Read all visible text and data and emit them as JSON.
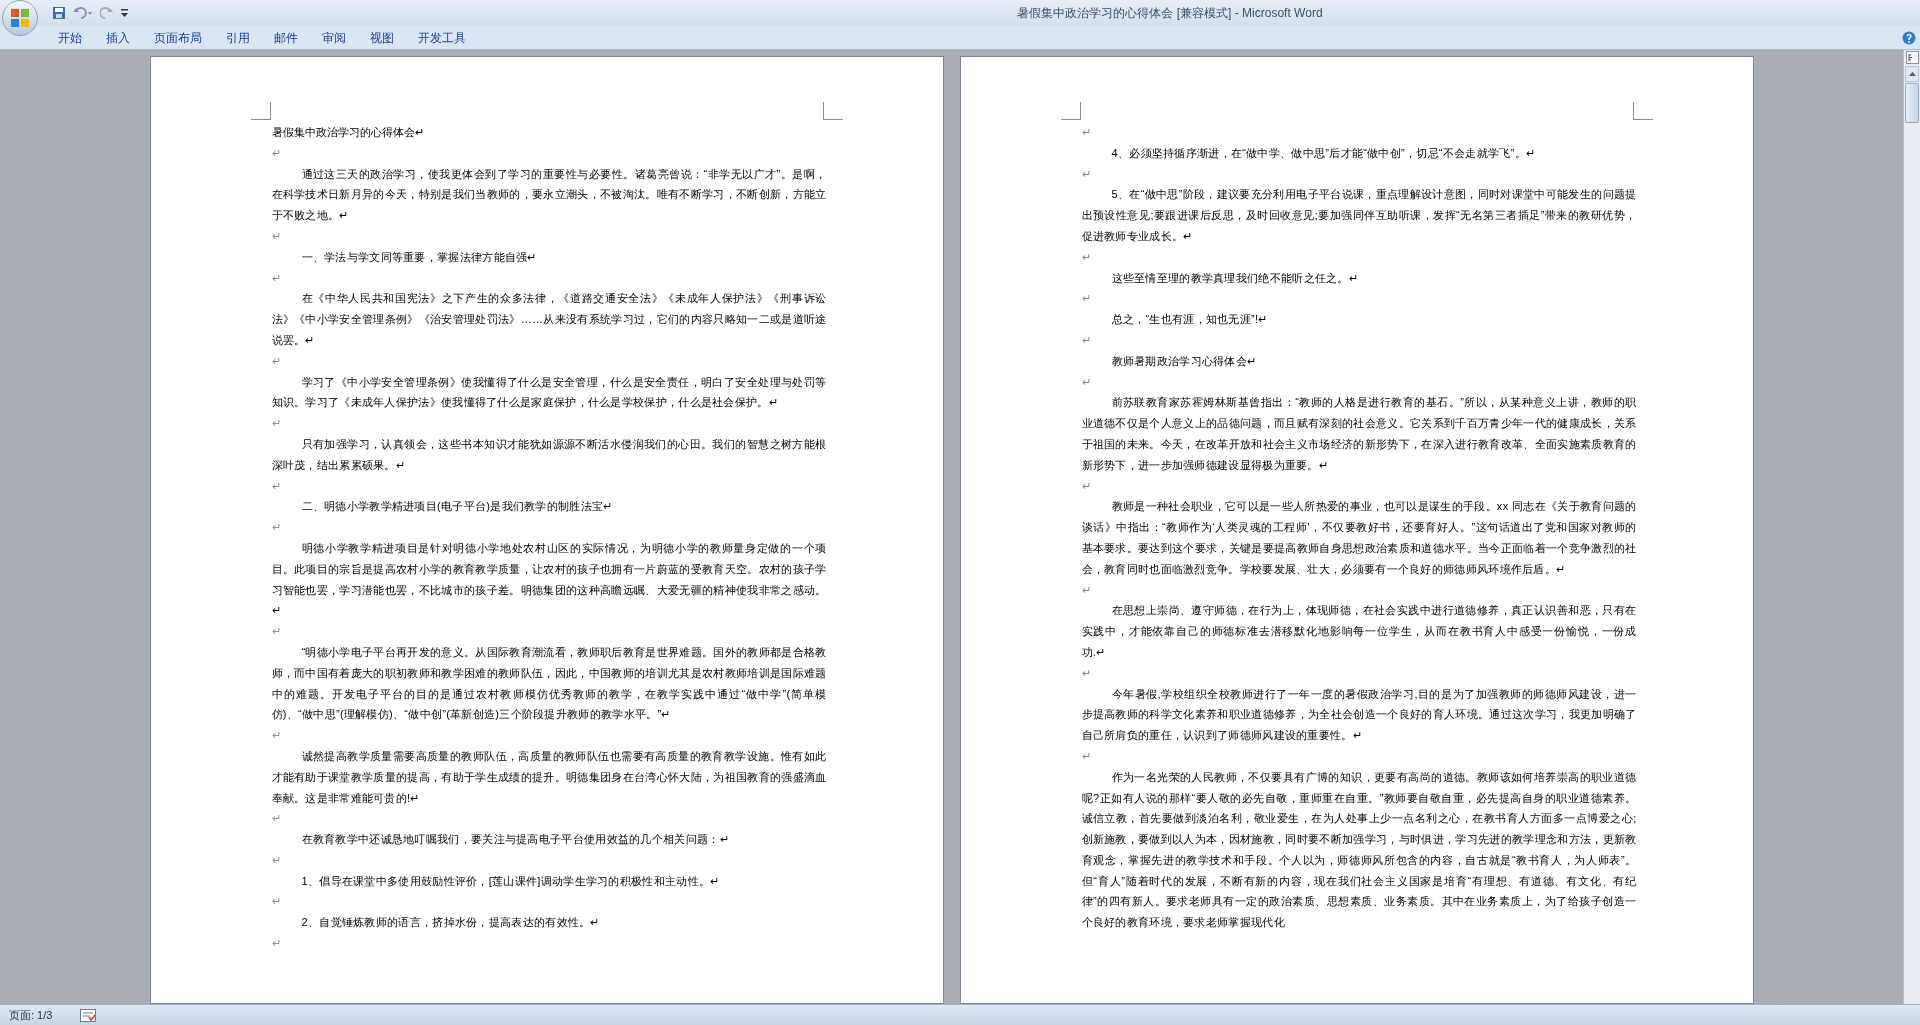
{
  "window": {
    "title": "暑假集中政治学习的心得体会 [兼容模式] - Microsoft Word"
  },
  "ribbon_tabs": [
    {
      "label": "开始",
      "selected": false
    },
    {
      "label": "插入",
      "selected": false
    },
    {
      "label": "页面布局",
      "selected": false
    },
    {
      "label": "引用",
      "selected": false
    },
    {
      "label": "邮件",
      "selected": false
    },
    {
      "label": "审阅",
      "selected": false
    },
    {
      "label": "视图",
      "selected": false
    },
    {
      "label": "开发工具",
      "selected": false
    }
  ],
  "pages": [
    {
      "paragraphs": [
        {
          "kind": "title",
          "text": "暑假集中政治学习的心得体会↵"
        },
        {
          "kind": "blank",
          "text": "↵"
        },
        {
          "kind": "para",
          "text": "通过这三天的政治学习，使我更体会到了学习的重要性与必要性。诸葛亮曾说：“非学无以广才”。是啊，在科学技术日新月异的今天，特别是我们当教师的，要永立潮头，不被淘汰。唯有不断学习，不断创新，方能立于不败之地。↵"
        },
        {
          "kind": "blank",
          "text": "↵"
        },
        {
          "kind": "para",
          "text": "一、学法与学文同等重要，掌握法律方能自强↵"
        },
        {
          "kind": "blank",
          "text": "↵"
        },
        {
          "kind": "para",
          "text": "在《中华人民共和国宪法》之下产生的众多法律，《道路交通安全法》《未成年人保护法》《刑事诉讼法》《中小学安全管理条例》《治安管理处罚法》……从来没有系统学习过，它们的内容只略知一二或是道听途说罢。↵"
        },
        {
          "kind": "blank",
          "text": "↵"
        },
        {
          "kind": "para",
          "text": "学习了《中小学安全管理条例》使我懂得了什么是安全管理，什么是安全责任，明白了安全处理与处罚等知识。学习了《未成年人保护法》使我懂得了什么是家庭保护，什么是学校保护，什么是社会保护。↵"
        },
        {
          "kind": "blank",
          "text": "↵"
        },
        {
          "kind": "para",
          "text": "只有加强学习，认真领会，这些书本知识才能犹如源源不断活水侵润我们的心田。我们的智慧之树方能根深叶茂，结出累累硕果。↵"
        },
        {
          "kind": "blank",
          "text": "↵"
        },
        {
          "kind": "para",
          "text": "二、明德小学教学精进项目(电子平台)是我们教学的制胜法宝↵"
        },
        {
          "kind": "blank",
          "text": "↵"
        },
        {
          "kind": "para",
          "text": "明德小学教学精进项目是针对明德小学地处农村山区的实际情况，为明德小学的教师量身定做的一个项目。此项目的宗旨是提高农村小学的教育教学质量，让农村的孩子也拥有一片蔚蓝的受教育天空。农村的孩子学习智能也罢，学习潜能也罢，不比城市的孩子差。明德集团的这种高瞻远瞩、大爱无疆的精神使我非常之感动。↵"
        },
        {
          "kind": "blank",
          "text": "↵"
        },
        {
          "kind": "para",
          "text": "“明德小学电子平台再开发的意义。从国际教育潮流看，教师职后教育是世界难题。国外的教师都是合格教师，而中国有着庞大的职初教师和教学困难的教师队伍，因此，中国教师的培训尤其是农村教师培训是国际难题中的难题。开发电子平台的目的是通过农村教师模仿优秀教师的教学，在教学实践中通过“做中学”(简单模仿)、“做中思”(理解模仿)、“做中创”(革新创造)三个阶段提升教师的教学水平。”↵"
        },
        {
          "kind": "blank",
          "text": "↵"
        },
        {
          "kind": "para",
          "text": "诚然提高教学质量需要高质量的教师队伍，高质量的教师队伍也需要有高质量的教育教学设施。惟有如此才能有助于课堂教学质量的提高，有助于学生成绩的提升。明德集团身在台湾心怀大陆，为祖国教育的强盛滴血奉献。这是非常难能可贵的!↵"
        },
        {
          "kind": "blank",
          "text": "↵"
        },
        {
          "kind": "para",
          "text": "在教育教学中还诚恳地叮嘱我们，要关注与提高电子平台使用效益的几个相关问题：↵"
        },
        {
          "kind": "blank",
          "text": "↵"
        },
        {
          "kind": "para",
          "text": "1、倡导在课堂中多使用鼓励性评价，[莲山课件]调动学生学习的积极性和主动性。↵"
        },
        {
          "kind": "blank",
          "text": "↵"
        },
        {
          "kind": "para",
          "text": "2、自觉锤炼教师的语言，挤掉水份，提高表达的有效性。↵"
        },
        {
          "kind": "blank",
          "text": "↵"
        }
      ]
    },
    {
      "paragraphs": [
        {
          "kind": "blank",
          "text": "↵"
        },
        {
          "kind": "para",
          "text": "4、必须坚持循序渐进，在“做中学、做中思”后才能“做中创”，切忌“不会走就学飞”。↵"
        },
        {
          "kind": "blank",
          "text": "↵"
        },
        {
          "kind": "para",
          "text": "5、在“做中思”阶段，建议要充分利用电子平台说课，重点理解设计意图，同时对课堂中可能发生的问题提出预设性意见;要跟进课后反思，及时回收意见;要加强同伴互助听课，发挥“无名第三者插足”带来的教研优势，促进教师专业成长。↵"
        },
        {
          "kind": "blank",
          "text": "↵"
        },
        {
          "kind": "para",
          "text": "这些至情至理的教学真理我们绝不能听之任之。↵"
        },
        {
          "kind": "blank",
          "text": "↵"
        },
        {
          "kind": "para",
          "text": "总之，“生也有涯，知也无涯”!↵"
        },
        {
          "kind": "blank",
          "text": "↵"
        },
        {
          "kind": "para",
          "text": "教师暑期政治学习心得体会↵"
        },
        {
          "kind": "blank",
          "text": "↵"
        },
        {
          "kind": "para",
          "text": "前苏联教育家苏霍姆林斯基曾指出：“教师的人格是进行教育的基石。”所以，从某种意义上讲，教师的职业道德不仅是个人意义上的品德问题，而且赋有深刻的社会意义。它关系到千百万青少年一代的健康成长，关系于祖国的未来。今天，在改革开放和社会主义市场经济的新形势下，在深入进行教育改革、全面实施素质教育的新形势下，进一步加强师德建设显得极为重要。↵"
        },
        {
          "kind": "blank",
          "text": "↵"
        },
        {
          "kind": "para",
          "text": "教师是一种社会职业，它可以是一些人所热爱的事业，也可以是谋生的手段。xx 同志在《关于教育问题的谈话》中指出：“教师作为‘人类灵魂的工程师’，不仅要教好书，还要育好人。”这句话道出了党和国家对教师的基本要求。要达到这个要求，关键是要提高教师自身思想政治素质和道德水平。当今正面临着一个竞争激烈的社会，教育同时也面临激烈竞争。学校要发展、壮大，必须要有一个良好的师德师风环境作后盾。↵"
        },
        {
          "kind": "blank",
          "text": "↵"
        },
        {
          "kind": "para",
          "text": "在思想上崇尚、遵守师德，在行为上，体现师德，在社会实践中进行道德修养，真正认识善和恶，只有在实践中，才能依靠自己的师德标准去潜移默化地影响每一位学生，从而在教书育人中感受一份愉悦，一份成功.↵"
        },
        {
          "kind": "blank",
          "text": "↵"
        },
        {
          "kind": "para",
          "text": "今年暑假,学校组织全校教师进行了一年一度的暑假政治学习,目的是为了加强教师的师德师风建设，进一步提高教师的科学文化素养和职业道德修养，为全社会创造一个良好的育人环境。通过这次学习，我更加明确了自己所肩负的重任，认识到了师德师风建设的重要性。↵"
        },
        {
          "kind": "blank",
          "text": "↵"
        },
        {
          "kind": "para",
          "text": "作为一名光荣的人民教师，不仅要具有广博的知识，更要有高尚的道德。教师该如何培养崇高的职业道德呢?正如有人说的那样“要人敬的必先自敬，重师重在自重。”教师要自敬自重，必先提高自身的职业道德素养。诚信立教，首先要做到淡泊名利，敬业爱生，在为人处事上少一点名利之心，在教书育人方面多一点博爱之心;创新施教，要做到以人为本，因材施教，同时要不断加强学习，与时俱进，学习先进的教学理念和方法，更新教育观念，掌握先进的教学技术和手段。个人以为，师德师风所包含的内容，自古就是“教书育人，为人师表”。但“育人”随着时代的发展，不断有新的内容，现在我们社会主义国家是培育“有理想、有道德、有文化、有纪律”的四有新人。要求老师具有一定的政治素质、思想素质、业务素质。其中在业务素质上，为了给孩子创造一个良好的教育环境，要求老师掌握现代化"
        }
      ]
    }
  ],
  "status_bar": {
    "page": "页面: 1/3"
  }
}
